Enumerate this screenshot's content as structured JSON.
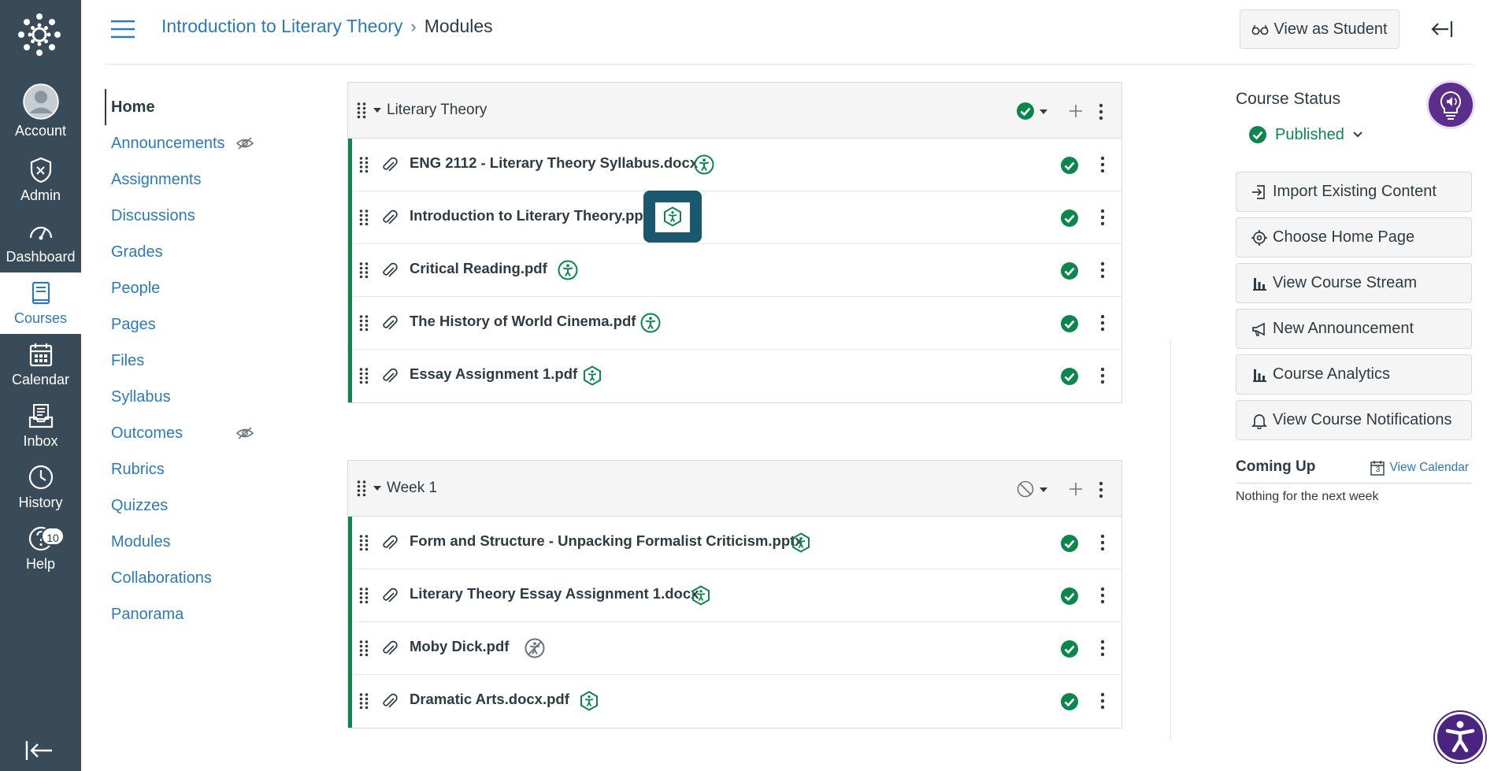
{
  "global_nav": {
    "items": [
      {
        "label": "Account",
        "icon": "avatar-icon"
      },
      {
        "label": "Admin",
        "icon": "shield-icon"
      },
      {
        "label": "Dashboard",
        "icon": "dashboard-icon"
      },
      {
        "label": "Courses",
        "icon": "book-icon"
      },
      {
        "label": "Calendar",
        "icon": "calendar-icon"
      },
      {
        "label": "Inbox",
        "icon": "inbox-icon"
      },
      {
        "label": "History",
        "icon": "clock-icon"
      },
      {
        "label": "Help",
        "icon": "help-icon",
        "badge": "10"
      }
    ],
    "active": "Courses"
  },
  "header": {
    "breadcrumb_course": "Introduction to Literary Theory",
    "breadcrumb_separator": "›",
    "breadcrumb_current": "Modules",
    "view_as_student": "View as Student"
  },
  "course_nav": {
    "items": [
      {
        "label": "Home",
        "active": true
      },
      {
        "label": "Announcements",
        "hidden": true
      },
      {
        "label": "Assignments"
      },
      {
        "label": "Discussions"
      },
      {
        "label": "Grades"
      },
      {
        "label": "People"
      },
      {
        "label": "Pages"
      },
      {
        "label": "Files"
      },
      {
        "label": "Syllabus"
      },
      {
        "label": "Outcomes",
        "hidden": true
      },
      {
        "label": "Rubrics"
      },
      {
        "label": "Quizzes"
      },
      {
        "label": "Modules"
      },
      {
        "label": "Collaborations"
      },
      {
        "label": "Panorama"
      }
    ]
  },
  "modules": [
    {
      "title": "Literary Theory",
      "status": "published",
      "items": [
        {
          "title": "ENG 2112 - Literary Theory Syllabus.docx",
          "a11y": "accessible"
        },
        {
          "title": "Introduction to Literary Theory.pptx",
          "a11y": "alternative",
          "focused": true
        },
        {
          "title": "Critical Reading.pdf",
          "a11y": "accessible"
        },
        {
          "title": "The History of World Cinema.pdf",
          "a11y": "accessible"
        },
        {
          "title": "Essay Assignment 1.pdf",
          "a11y": "alternative"
        }
      ]
    },
    {
      "title": "Week 1",
      "status": "unpublished",
      "items": [
        {
          "title": "Form and Structure - Unpacking Formalist Criticism.pptx",
          "a11y": "alternative"
        },
        {
          "title": "Literary Theory Essay Assignment 1.docx",
          "a11y": "alternative"
        },
        {
          "title": "Moby Dick.pdf",
          "a11y": "inaccessible"
        },
        {
          "title": "Dramatic Arts.docx.pdf",
          "a11y": "alternative"
        }
      ]
    }
  ],
  "sidebar": {
    "course_status_title": "Course Status",
    "published_label": "Published",
    "buttons": [
      {
        "label": "Import Existing Content",
        "icon": "import-icon"
      },
      {
        "label": "Choose Home Page",
        "icon": "target-icon"
      },
      {
        "label": "View Course Stream",
        "icon": "bar-chart-icon"
      },
      {
        "label": "New Announcement",
        "icon": "megaphone-icon"
      },
      {
        "label": "Course Analytics",
        "icon": "bar-chart-icon"
      },
      {
        "label": "View Course Notifications",
        "icon": "bell-icon"
      }
    ],
    "coming_up_title": "Coming Up",
    "view_calendar": "View Calendar",
    "calendar_day": "3",
    "nothing_text": "Nothing for the next week"
  },
  "colors": {
    "nav_bg": "#394b58",
    "link": "#2b7abc",
    "success": "#0b874b",
    "focus": "#19586e",
    "purple": "#5a2e8a"
  }
}
